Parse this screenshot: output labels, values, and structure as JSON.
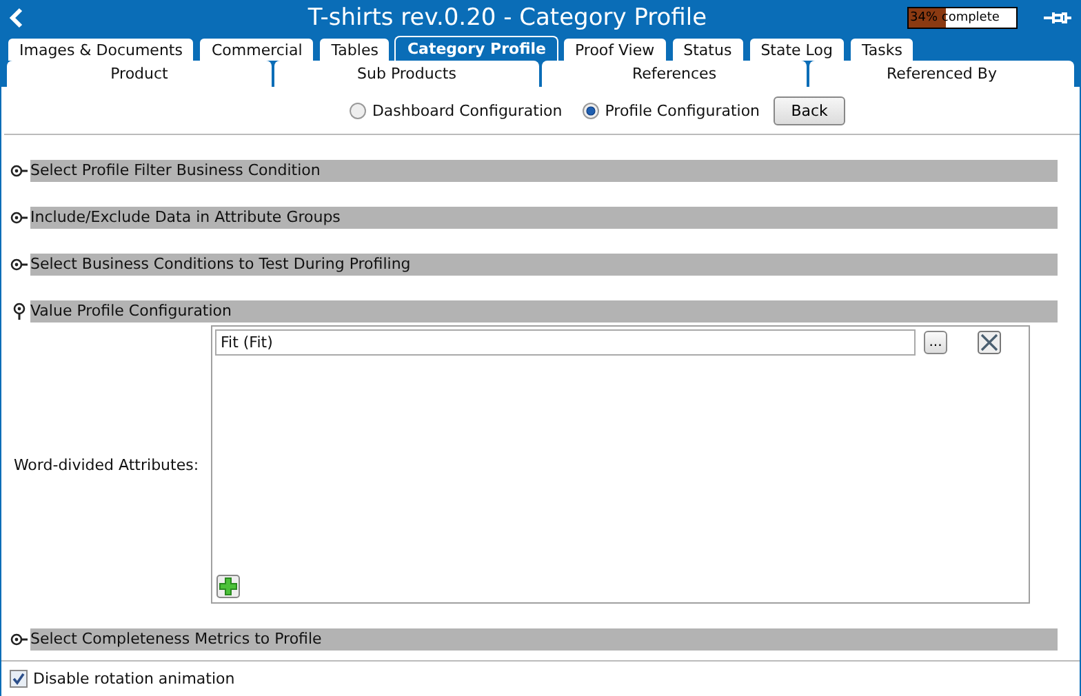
{
  "window": {
    "title": "T-shirts rev.0.20 - Category Profile",
    "progress": {
      "level": 0.34,
      "label": "34% complete"
    }
  },
  "tabs": [
    {
      "label": "Images & Documents",
      "selected": false
    },
    {
      "label": "Commercial",
      "selected": false
    },
    {
      "label": "Tables",
      "selected": false
    },
    {
      "label": "Category Profile",
      "selected": true
    },
    {
      "label": "Proof View",
      "selected": false
    },
    {
      "label": "Status",
      "selected": false
    },
    {
      "label": "State Log",
      "selected": false
    },
    {
      "label": "Tasks",
      "selected": false
    }
  ],
  "subtabs": [
    {
      "label": "Product",
      "selected": false
    },
    {
      "label": "Sub Products",
      "selected": false
    },
    {
      "label": "References",
      "selected": false
    },
    {
      "label": "Referenced By",
      "selected": false
    }
  ],
  "mode": {
    "options": [
      {
        "label": "Dashboard Configuration",
        "selected": false
      },
      {
        "label": "Profile Configuration",
        "selected": true
      }
    ],
    "back_button": "Back"
  },
  "sections": [
    {
      "title": "Select Profile Filter Business Condition",
      "expanded": false
    },
    {
      "title": "Include/Exclude Data in Attribute Groups",
      "expanded": false
    },
    {
      "title": "Select Business Conditions to Test During Profiling",
      "expanded": false
    },
    {
      "title": "Value Profile Configuration",
      "expanded": true,
      "field_label": "Word-divided Attributes:",
      "values": [
        "Fit (Fit)"
      ],
      "browse_button": "..."
    },
    {
      "title": "Select Completeness Metrics to Profile",
      "expanded": false
    }
  ],
  "footer": {
    "checkbox": {
      "label": "Disable rotation animation",
      "checked": true
    }
  }
}
